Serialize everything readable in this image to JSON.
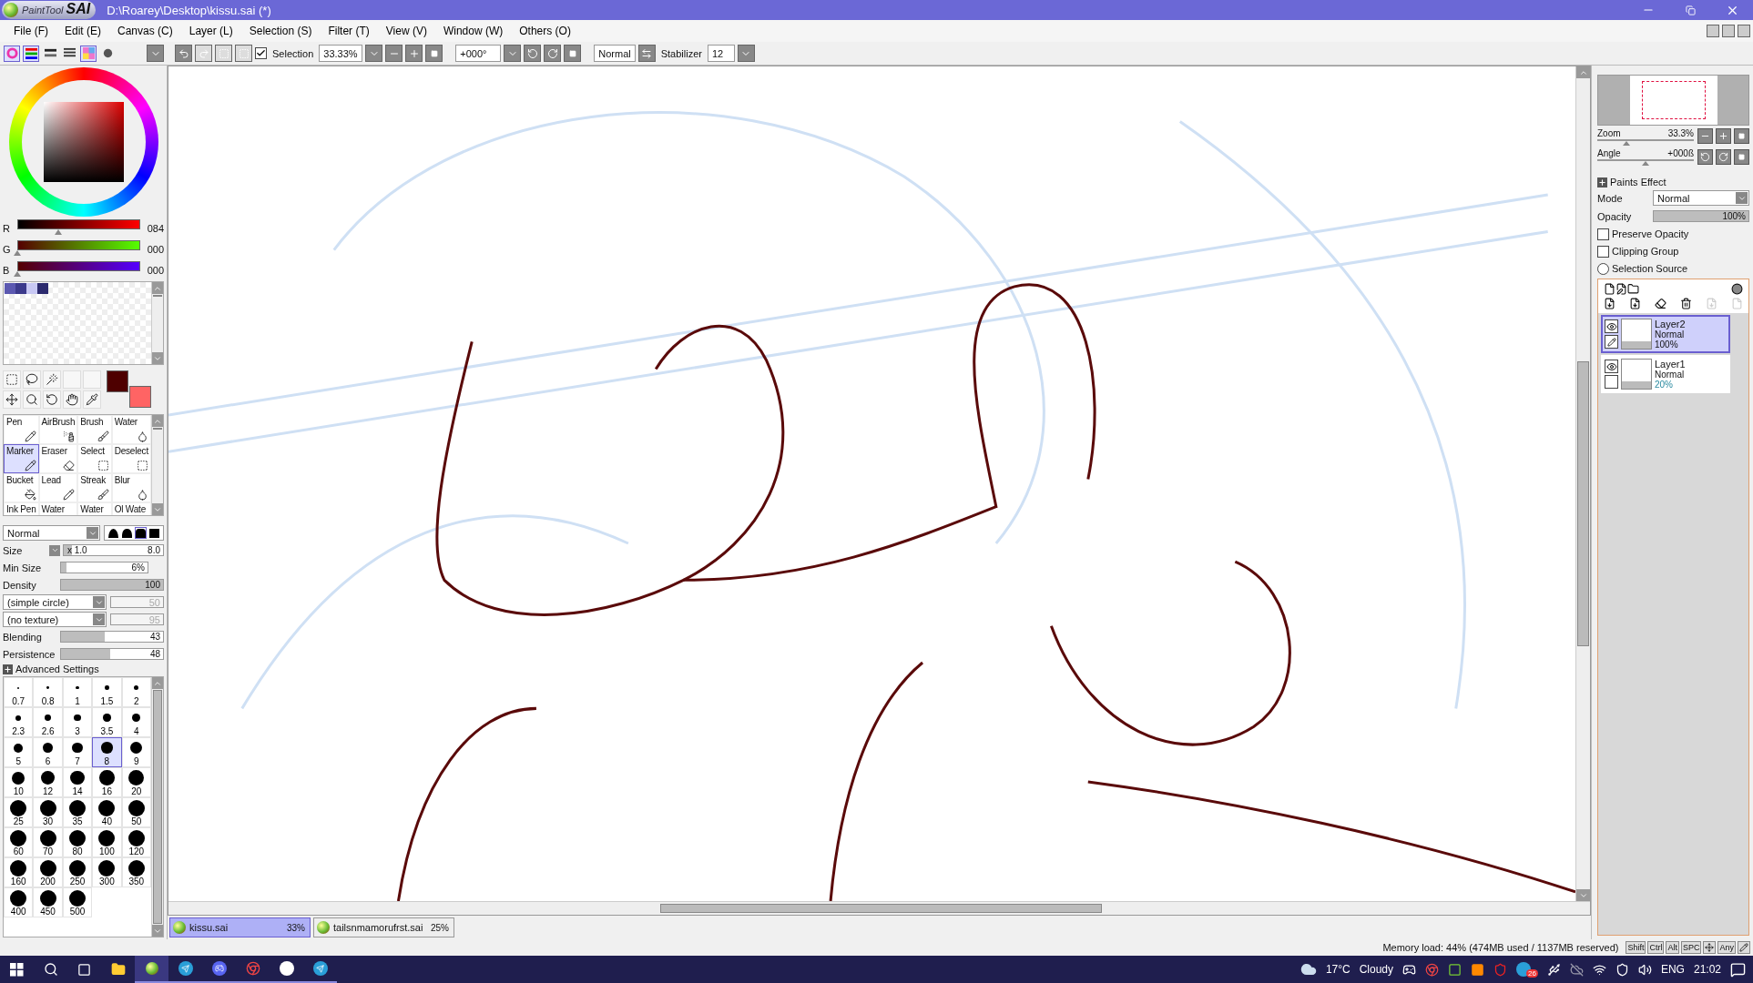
{
  "window": {
    "logo": [
      "PaintTool",
      "SAI"
    ],
    "title": "D:\\Roarey\\Desktop\\kissu.sai (*)"
  },
  "menu": [
    "File (F)",
    "Edit (E)",
    "Canvas (C)",
    "Layer (L)",
    "Selection (S)",
    "Filter (T)",
    "View (V)",
    "Window (W)",
    "Others (O)"
  ],
  "color_modes": [
    {
      "selected": true
    },
    {
      "selected": true
    },
    {
      "selected": false
    },
    {
      "selected": false
    },
    {
      "selected": true
    },
    {
      "selected": false
    }
  ],
  "toolbar": {
    "selection": {
      "label": "Selection",
      "checked": true
    },
    "zoom": "33.33%",
    "angle": "+000°",
    "blend": "Normal",
    "stabilizer_label": "Stabilizer",
    "stabilizer": "12"
  },
  "rgb": [
    {
      "label": "R",
      "level": 0.33,
      "value": "084"
    },
    {
      "label": "G",
      "level": 0.0,
      "value": "000"
    },
    {
      "label": "B",
      "level": 0.0,
      "value": "000"
    }
  ],
  "swatches": [
    {
      "color": "#5b58b0"
    },
    {
      "color": "#3c3a8c"
    },
    {
      "color": "#c8c8f4"
    },
    {
      "color": "#2c2a6e"
    }
  ],
  "colors": [
    {
      "kind": "primary",
      "color": "#4e0000"
    },
    {
      "kind": "secondary",
      "color": "#ff6464"
    }
  ],
  "brush_tools": [
    {
      "label": "Pen",
      "selected": false
    },
    {
      "label": "AirBrush",
      "selected": false
    },
    {
      "label": "Brush",
      "selected": false
    },
    {
      "label": "Water",
      "selected": false
    },
    {
      "label": "Marker",
      "selected": true
    },
    {
      "label": "Eraser",
      "selected": false
    },
    {
      "label": "Select",
      "selected": false
    },
    {
      "label": "Deselect",
      "selected": false
    },
    {
      "label": "Bucket",
      "selected": false
    },
    {
      "label": "Lead",
      "selected": false
    },
    {
      "label": "Streak",
      "selected": false
    },
    {
      "label": "Blur",
      "selected": false
    },
    {
      "label": "Ink Pen",
      "selected": false
    },
    {
      "label": "Water",
      "selected": false
    },
    {
      "label": "Water",
      "selected": false
    },
    {
      "label": "Ol Wate",
      "selected": false
    }
  ],
  "brush": {
    "blend": "Normal",
    "edges": [
      {
        "selected": false
      },
      {
        "selected": false
      },
      {
        "selected": true
      },
      {
        "selected": false
      }
    ],
    "size": {
      "label": "Size",
      "factor": "x 1.0",
      "value": "8.0",
      "level": 0.08
    },
    "min_size": {
      "label": "Min Size",
      "value": "6%",
      "level": 0.06
    },
    "density": {
      "label": "Density",
      "value": "100",
      "level": 1.0
    },
    "shape": {
      "value": "(simple circle)",
      "amount": "50"
    },
    "texture": {
      "value": "(no texture)",
      "amount": "95"
    },
    "blending": {
      "label": "Blending",
      "value": "43",
      "level": 0.43
    },
    "persistence": {
      "label": "Persistence",
      "value": "48",
      "level": 0.48
    },
    "advanced": "Advanced Settings"
  },
  "brush_sizes": [
    {
      "label": "0.7",
      "selected": false
    },
    {
      "label": "0.8",
      "selected": false
    },
    {
      "label": "1",
      "selected": false
    },
    {
      "label": "1.5",
      "selected": false
    },
    {
      "label": "2",
      "selected": false
    },
    {
      "label": "2.3",
      "selected": false
    },
    {
      "label": "2.6",
      "selected": false
    },
    {
      "label": "3",
      "selected": false
    },
    {
      "label": "3.5",
      "selected": false
    },
    {
      "label": "4",
      "selected": false
    },
    {
      "label": "5",
      "selected": false
    },
    {
      "label": "6",
      "selected": false
    },
    {
      "label": "7",
      "selected": false
    },
    {
      "label": "8",
      "selected": true
    },
    {
      "label": "9",
      "selected": false
    },
    {
      "label": "10",
      "selected": false
    },
    {
      "label": "12",
      "selected": false
    },
    {
      "label": "14",
      "selected": false
    },
    {
      "label": "16",
      "selected": false
    },
    {
      "label": "20",
      "selected": false
    },
    {
      "label": "25",
      "selected": false
    },
    {
      "label": "30",
      "selected": false
    },
    {
      "label": "35",
      "selected": false
    },
    {
      "label": "40",
      "selected": false
    },
    {
      "label": "50",
      "selected": false
    },
    {
      "label": "60",
      "selected": false
    },
    {
      "label": "70",
      "selected": false
    },
    {
      "label": "80",
      "selected": false
    },
    {
      "label": "100",
      "selected": false
    },
    {
      "label": "120",
      "selected": false
    },
    {
      "label": "160",
      "selected": false
    },
    {
      "label": "200",
      "selected": false
    },
    {
      "label": "250",
      "selected": false
    },
    {
      "label": "300",
      "selected": false
    },
    {
      "label": "350",
      "selected": false
    },
    {
      "label": "400",
      "selected": false
    },
    {
      "label": "450",
      "selected": false
    },
    {
      "label": "500",
      "selected": false
    }
  ],
  "documents": [
    {
      "name": "kissu.sai",
      "zoom": "33%",
      "selected": true
    },
    {
      "name": "tailsnmamorufrst.sai",
      "zoom": "25%",
      "selected": false
    }
  ],
  "navigator": {
    "zoom": {
      "label": "Zoom",
      "value": "33.3%",
      "level": 0.3
    },
    "angle": {
      "label": "Angle",
      "value": "+000ß",
      "level": 0.5
    }
  },
  "layer_props": {
    "paints_effect": "Paints Effect",
    "mode_label": "Mode",
    "mode": "Normal",
    "opacity_label": "Opacity",
    "opacity": {
      "value": "100%",
      "level": 1.0
    },
    "options": [
      {
        "label": "Preserve Opacity",
        "kind": "checkbox",
        "checked": false
      },
      {
        "label": "Clipping Group",
        "kind": "checkbox",
        "checked": false
      },
      {
        "label": "Selection Source",
        "kind": "radio",
        "checked": false
      }
    ]
  },
  "layers": [
    {
      "name": "Layer2",
      "mode": "Normal",
      "opacity": "100%",
      "selected": true,
      "visible": true,
      "editing": true
    },
    {
      "name": "Layer1",
      "mode": "Normal",
      "opacity": "20%",
      "selected": false,
      "visible": true,
      "editing": false
    }
  ],
  "status": {
    "memory": "Memory load: 44% (474MB used / 1137MB reserved)",
    "keys": [
      "Shift",
      "Ctrl",
      "Alt",
      "SPC"
    ],
    "any": "Any"
  },
  "taskbar": {
    "weather": {
      "temp": "17°C",
      "text": "Cloudy"
    },
    "badge": "26",
    "language": "ENG",
    "time": "21:02"
  }
}
